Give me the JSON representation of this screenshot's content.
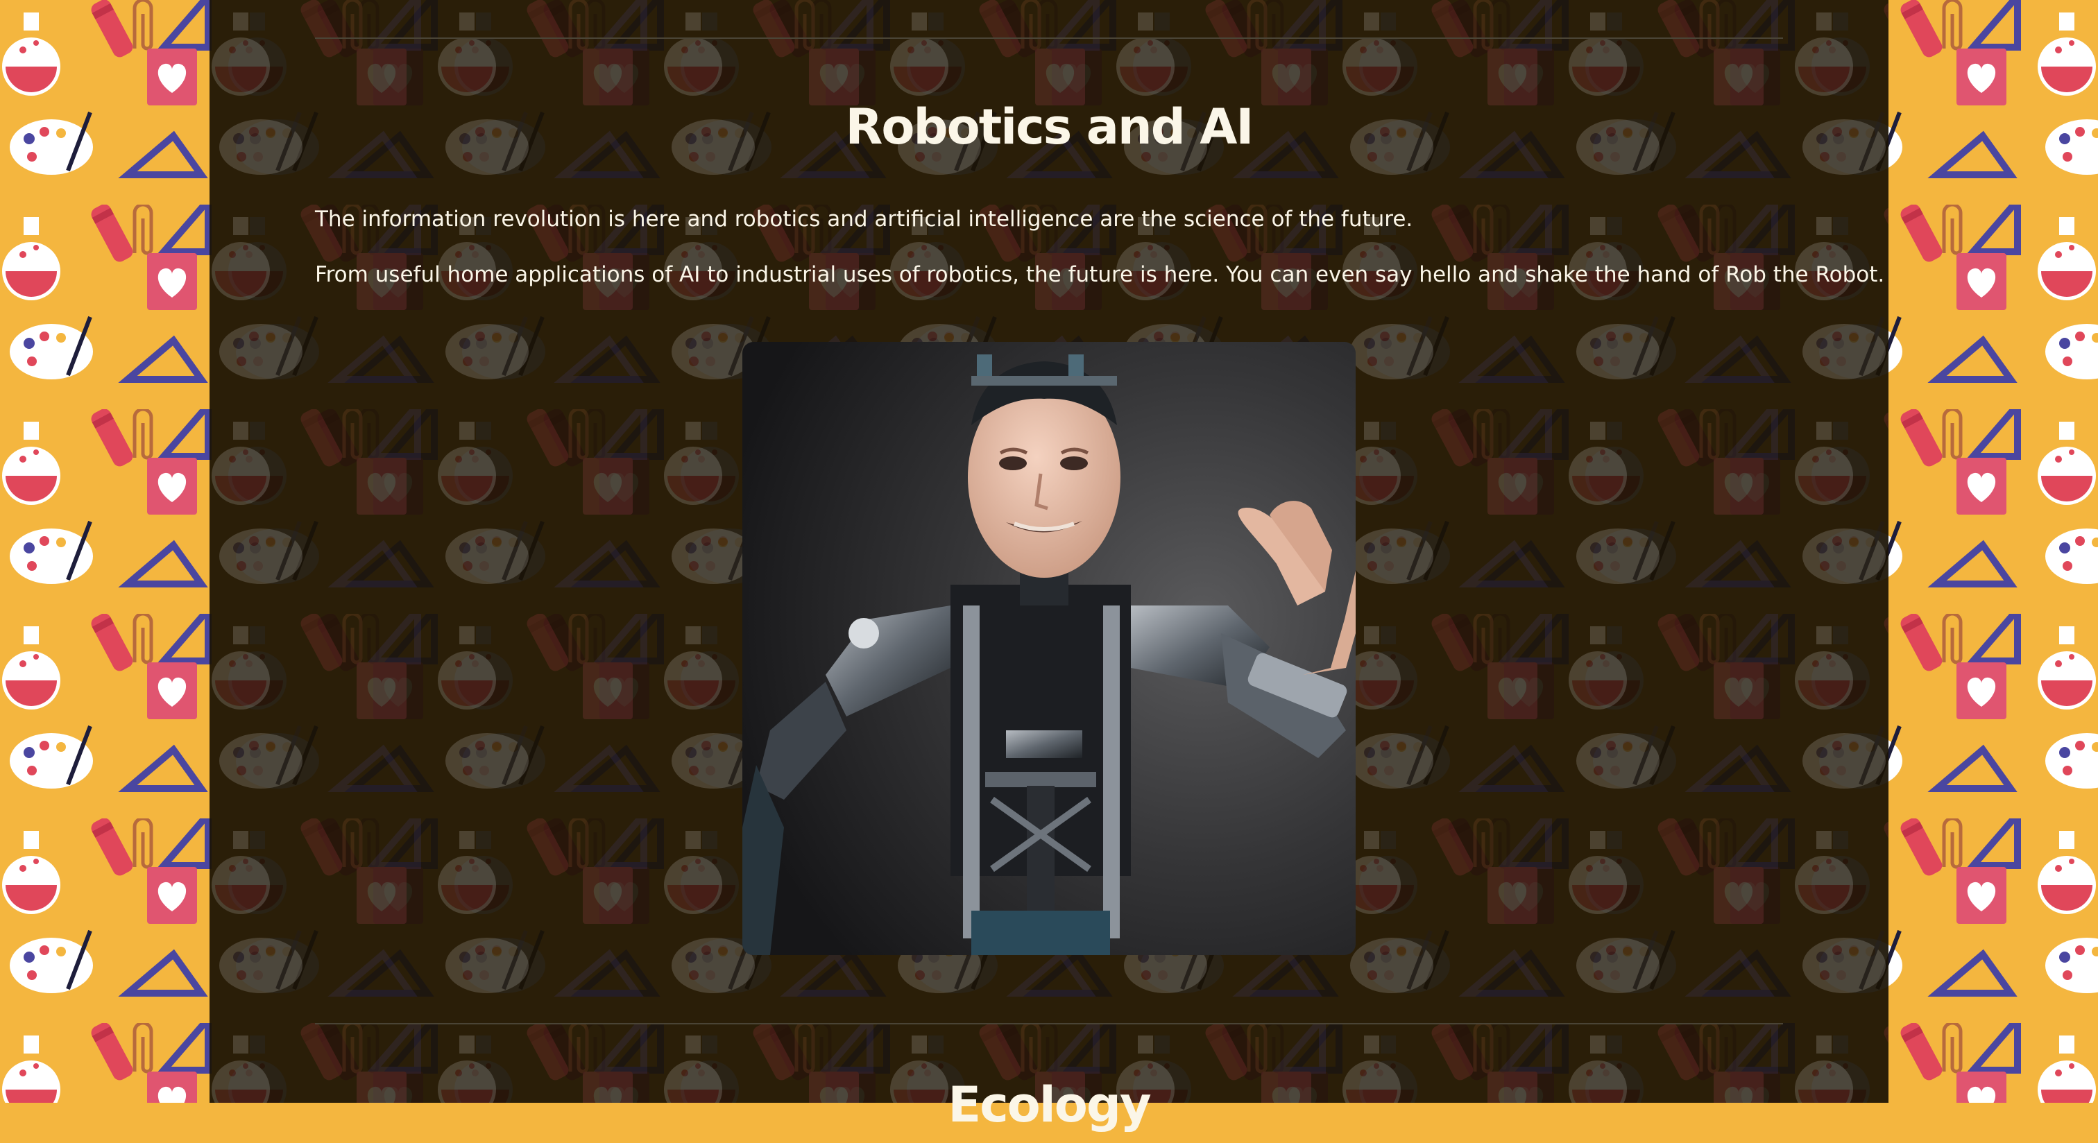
{
  "section": {
    "title": "Robotics and AI",
    "paragraphs": [
      "The information revolution is here and robotics and artificial intelligence are the science of the future.",
      "From useful home applications of AI to industrial uses of robotics, the future is here. You can even say hello and shake the hand of Rob the Robot."
    ]
  },
  "next_section": {
    "title": "Ecology"
  },
  "colors": {
    "page_background": "#f4b63f",
    "panel": "#1a1204",
    "text": "#fbf6e8",
    "divider": "#4a4436",
    "pattern_flask": "#e0475a",
    "pattern_triangle": "#4a46a0",
    "pattern_note": "#e05570"
  },
  "icons": [
    "flask-icon",
    "palette-icon",
    "triangle-ruler-icon",
    "paperclip-icon",
    "crayon-icon",
    "heart-notepad-icon"
  ]
}
